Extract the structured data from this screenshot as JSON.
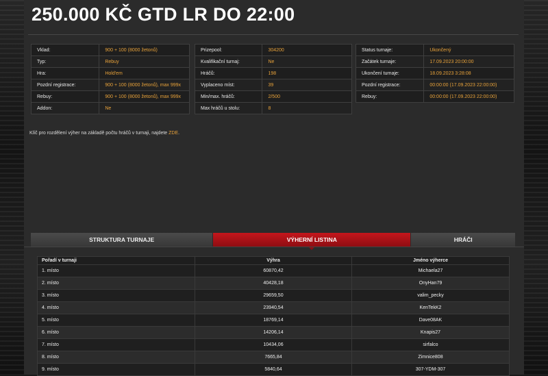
{
  "title": "250.000 KČ GTD LR DO 22:00",
  "info_left": [
    {
      "label": "Vklad:",
      "value": "900 + 100 (8000 žetonů)"
    },
    {
      "label": "Typ:",
      "value": "Rebuy"
    },
    {
      "label": "Hra:",
      "value": "Hold'em"
    },
    {
      "label": "Pozdní registrace:",
      "value": "900 + 100 (8000 žetonů), max 999x"
    },
    {
      "label": "Rebuy:",
      "value": "900 + 100 (8000 žetonů), max 999x"
    },
    {
      "label": "Addon:",
      "value": "Ne"
    }
  ],
  "info_mid": [
    {
      "label": "Prizepool:",
      "value": "304200"
    },
    {
      "label": "Kvalifikační turnaj:",
      "value": "Ne"
    },
    {
      "label": "Hráčů:",
      "value": "198"
    },
    {
      "label": "Vyplaceno míst:",
      "value": "39"
    },
    {
      "label": "Min/max. hráčů:",
      "value": "2/500"
    },
    {
      "label": "Max hráčů u stolu:",
      "value": "8"
    }
  ],
  "info_right": [
    {
      "label": "Status turnaje:",
      "value": "Ukončený"
    },
    {
      "label": "Začátek turnaje:",
      "value": "17.09.2023 20:00:00"
    },
    {
      "label": "Ukončení turnaje:",
      "value": "18.09.2023 3:28:08"
    },
    {
      "label": "Pozdní registrace:",
      "value": "00:00:00 (17.09.2023 22:00:00)"
    },
    {
      "label": "Rebuy:",
      "value": "00:00:00 (17.09.2023 22:00:00)"
    }
  ],
  "note": {
    "text": "Klíč pro rozdělení výher na základě počtu hráčů v turnaji, najdete ",
    "link": "ZDE",
    "end": "."
  },
  "tabs": [
    {
      "label": "STRUKTURA TURNAJE",
      "active": false
    },
    {
      "label": "VÝHERNÍ LISTINA",
      "active": true
    },
    {
      "label": "HRÁČI",
      "active": false
    }
  ],
  "results": {
    "headers": [
      "Pořadí v turnaji",
      "Výhra",
      "Jméno výherce"
    ],
    "rows": [
      [
        "1. místo",
        "60870,42",
        "Michaela27"
      ],
      [
        "2. místo",
        "40428,18",
        "OnyHan79"
      ],
      [
        "3. místo",
        "29659,50",
        "valim_pecky"
      ],
      [
        "4. místo",
        "23940,54",
        "KenTekK2"
      ],
      [
        "5. místo",
        "18769,14",
        "Dave08AK"
      ],
      [
        "6. místo",
        "14206,14",
        "Knapis27"
      ],
      [
        "7. místo",
        "10434,06",
        "sirfalco"
      ],
      [
        "8. místo",
        "7665,84",
        "Zimnice808"
      ],
      [
        "9. místo",
        "5840,64",
        "307-YDM-307"
      ]
    ]
  }
}
